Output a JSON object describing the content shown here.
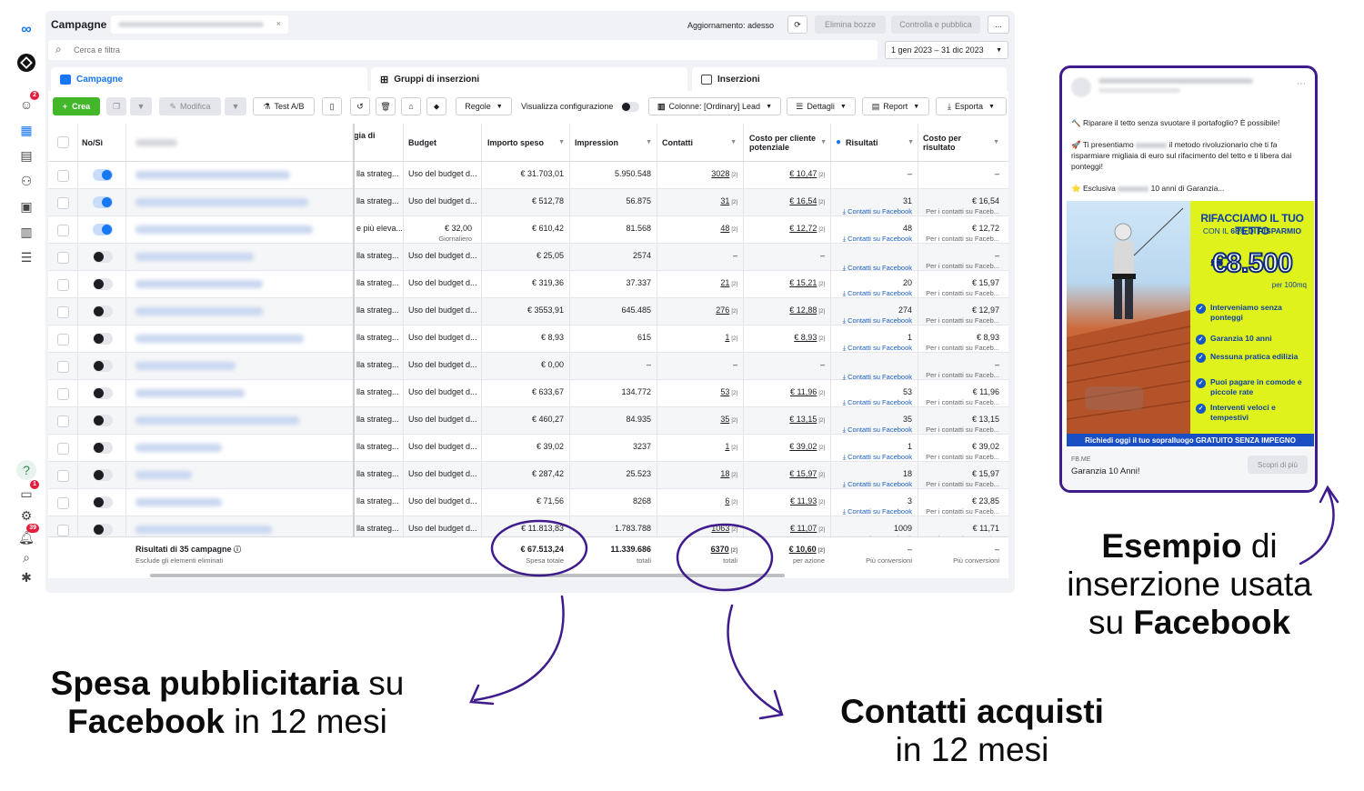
{
  "app": {
    "title": "Campagne",
    "update_status": "Aggiornamento: adesso",
    "discard_drafts": "Elimina bozze",
    "review_publish": "Controlla e pubblica",
    "more": "...",
    "search_placeholder": "Cerca e filtra",
    "date_range": "1 gen 2023 – 31 dic 2023"
  },
  "rail": {
    "badge_notifications": "2",
    "badge_inbox": "1",
    "badge_alerts": "39",
    "help": "?"
  },
  "tabs": [
    {
      "label": "Campagne"
    },
    {
      "label": "Gruppi di inserzioni"
    },
    {
      "label": "Inserzioni"
    }
  ],
  "toolbar": {
    "create": "Crea",
    "edit": "Modifica",
    "ab_test": "Test A/B",
    "rules": "Regole",
    "view_setup": "Visualizza configurazione",
    "columns": "Colonne: [Ordinary] Lead",
    "breakdown": "Dettagli",
    "report": "Report",
    "export": "Esporta"
  },
  "table": {
    "headers": {
      "toggle": "No/Sì",
      "strategy": "gia di",
      "budget": "Budget",
      "spend": "Importo speso",
      "impressions": "Impression",
      "contacts": "Contatti",
      "cpl_line1": "Costo per cliente",
      "cpl_line2": "potenziale",
      "results": "Risultati",
      "cpr_line1": "Costo per",
      "cpr_line2": "risultato"
    },
    "rows": [
      {
        "on": true,
        "w": 170,
        "strategy": "lla strateg...",
        "budget": "Uso del budget d...",
        "budget_sub": "",
        "spend": "€ 31.703,01",
        "impr": "5.950.548",
        "contacts": "3028",
        "cpl": "€ 10,47",
        "results": "–",
        "results_sub": "",
        "cpr": "–",
        "cpr_sub": ""
      },
      {
        "on": true,
        "w": 190,
        "strategy": "lla strateg...",
        "budget": "Uso del budget d...",
        "budget_sub": "",
        "spend": "€ 512,78",
        "impr": "56.875",
        "contacts": "31",
        "cpl": "€ 16,54",
        "results": "31",
        "results_sub": "Contatti su Facebook",
        "cpr": "€ 16,54",
        "cpr_sub": "Per i contatti su Faceb..."
      },
      {
        "on": true,
        "w": 195,
        "strategy": "e più eleva...",
        "budget": "€ 32,00",
        "budget_sub": "Giornaliero",
        "spend": "€ 610,42",
        "impr": "81.568",
        "contacts": "48",
        "cpl": "€ 12,72",
        "results": "48",
        "results_sub": "Contatti su Facebook",
        "cpr": "€ 12,72",
        "cpr_sub": "Per i contatti su Faceb..."
      },
      {
        "on": false,
        "w": 130,
        "strategy": "lla strateg...",
        "budget": "Uso del budget d...",
        "budget_sub": "",
        "spend": "€ 25,05",
        "impr": "2574",
        "contacts": "–",
        "cpl": "–",
        "results": "",
        "results_sub": "Contatti su Facebook",
        "cpr": "–",
        "cpr_sub": "Per i contatti su Faceb..."
      },
      {
        "on": false,
        "w": 140,
        "strategy": "lla strateg...",
        "budget": "Uso del budget d...",
        "budget_sub": "",
        "spend": "€ 319,36",
        "impr": "37.337",
        "contacts": "21",
        "cpl": "€ 15,21",
        "results": "20",
        "results_sub": "Contatti su Facebook",
        "cpr": "€ 15,97",
        "cpr_sub": "Per i contatti su Faceb..."
      },
      {
        "on": false,
        "w": 140,
        "strategy": "lla strateg...",
        "budget": "Uso del budget d...",
        "budget_sub": "",
        "spend": "€ 3553,91",
        "impr": "645.485",
        "contacts": "276",
        "cpl": "€ 12,88",
        "results": "274",
        "results_sub": "Contatti su Facebook",
        "cpr": "€ 12,97",
        "cpr_sub": "Per i contatti su Faceb..."
      },
      {
        "on": false,
        "w": 185,
        "strategy": "lla strateg...",
        "budget": "Uso del budget d...",
        "budget_sub": "",
        "spend": "€ 8,93",
        "impr": "615",
        "contacts": "1",
        "cpl": "€ 8,93",
        "results": "1",
        "results_sub": "Contatti su Facebook",
        "cpr": "€ 8,93",
        "cpr_sub": "Per i contatti su Faceb..."
      },
      {
        "on": false,
        "w": 110,
        "strategy": "lla strateg...",
        "budget": "Uso del budget d...",
        "budget_sub": "",
        "spend": "€ 0,00",
        "impr": "–",
        "contacts": "–",
        "cpl": "–",
        "results": "",
        "results_sub": "Contatti su Facebook",
        "cpr": "–",
        "cpr_sub": "Per i contatti su Faceb..."
      },
      {
        "on": false,
        "w": 120,
        "strategy": "lla strateg...",
        "budget": "Uso del budget d...",
        "budget_sub": "",
        "spend": "€ 633,67",
        "impr": "134.772",
        "contacts": "53",
        "cpl": "€ 11,96",
        "results": "53",
        "results_sub": "Contatti su Facebook",
        "cpr": "€ 11,96",
        "cpr_sub": "Per i contatti su Faceb..."
      },
      {
        "on": false,
        "w": 180,
        "strategy": "lla strateg...",
        "budget": "Uso del budget d...",
        "budget_sub": "",
        "spend": "€ 460,27",
        "impr": "84.935",
        "contacts": "35",
        "cpl": "€ 13,15",
        "results": "35",
        "results_sub": "Contatti su Facebook",
        "cpr": "€ 13,15",
        "cpr_sub": "Per i contatti su Faceb..."
      },
      {
        "on": false,
        "w": 95,
        "strategy": "lla strateg...",
        "budget": "Uso del budget d...",
        "budget_sub": "",
        "spend": "€ 39,02",
        "impr": "3237",
        "contacts": "1",
        "cpl": "€ 39,02",
        "results": "1",
        "results_sub": "Contatti su Facebook",
        "cpr": "€ 39,02",
        "cpr_sub": "Per i contatti su Faceb..."
      },
      {
        "on": false,
        "w": 62,
        "strategy": "lla strateg...",
        "budget": "Uso del budget d...",
        "budget_sub": "",
        "spend": "€ 287,42",
        "impr": "25.523",
        "contacts": "18",
        "cpl": "€ 15,97",
        "results": "18",
        "results_sub": "Contatti su Facebook",
        "cpr": "€ 15,97",
        "cpr_sub": "Per i contatti su Faceb..."
      },
      {
        "on": false,
        "w": 95,
        "strategy": "lla strateg...",
        "budget": "Uso del budget d...",
        "budget_sub": "",
        "spend": "€ 71,56",
        "impr": "8268",
        "contacts": "6",
        "cpl": "€ 11,93",
        "results": "3",
        "results_sub": "Contatti su Facebook",
        "cpr": "€ 23,85",
        "cpr_sub": "Per i contatti su Faceb..."
      },
      {
        "on": false,
        "w": 150,
        "strategy": "lla strateg...",
        "budget": "Uso del budget d...",
        "budget_sub": "",
        "spend": "€ 11.813,83",
        "impr": "1.783.788",
        "contacts": "1063",
        "cpl": "€ 11,07",
        "results": "1009",
        "results_sub": "Contatti su Facebook",
        "cpr": "€ 11,71",
        "cpr_sub": "Per i contatti su Faceb..."
      }
    ],
    "summary": {
      "label": "Risultati di 35 campagne",
      "sub": "Esclude gli elementi eliminati",
      "spend": "€ 67.513,24",
      "spend_sub": "Spesa totale",
      "impr": "11.339.686",
      "impr_sub": "totali",
      "contacts": "6370",
      "contacts_sub": "totali",
      "cpl": "€ 10,60",
      "cpl_sub": "per azione",
      "results": "–",
      "results_sub": "Più conversioni",
      "cpr": "–",
      "cpr_sub": "Più conversioni"
    }
  },
  "ad": {
    "line1": "🔨 Riparare il tetto senza svuotare il portafoglio? È possibile!",
    "line2": "🚀 Ti presentiamo",
    "line2b": "il metodo rivoluzionario che ti fa risparmiare migliaia di euro sul rifacimento del tetto e ti libera dai ponteggi!",
    "line3": "⭐ Esclusiva",
    "line3b": "10 anni di Garanzia...",
    "headline1": "RIFACCIAMO IL TUO TETTO",
    "headline2a": "CON IL ",
    "headline2b": "68%",
    "headline2c": " DI RISPARMIO",
    "price": "€8.500",
    "price_unit": "per 100mq",
    "checks": [
      "Interveniamo senza ponteggi",
      "Garanzia 10 anni",
      "Nessuna pratica edilizia",
      "Puoi pagare in comode e piccole rate",
      "Interventi veloci e tempestivi"
    ],
    "cta_bar": "Richiedi oggi il tuo sopralluogo GRATUITO SENZA IMPEGNO",
    "domain": "FB.ME",
    "link_title": "Garanzia 10 Anni!",
    "cta_button": "Scopri di più"
  },
  "callouts": {
    "example_b": "Esempio",
    "example_1": " di",
    "example_2": "inserzione usata",
    "example_3a": "su ",
    "example_3b": "Facebook",
    "spend_b": "Spesa pubblicitaria",
    "spend_1": " su",
    "spend_2b": "Facebook",
    "spend_2": " in 12 mesi",
    "contacts_b": "Contatti acquisti",
    "contacts_2": "in 12 mesi"
  },
  "colors": {
    "accent": "#1877f2",
    "create": "#42b72a",
    "annotation": "#3f1b8c",
    "banner_yellow": "#dff21b"
  }
}
